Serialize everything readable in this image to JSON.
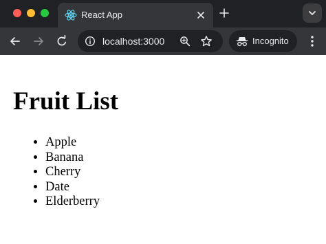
{
  "browser": {
    "tab_title": "React App",
    "url": "localhost:3000",
    "incognito_label": "Incognito",
    "icons": {
      "window_controls": [
        "close-window-icon",
        "minimize-window-icon",
        "maximize-window-icon"
      ],
      "tab": [
        "react-logo-icon",
        "close-icon"
      ],
      "tab_strip": [
        "plus-icon",
        "chevron-down-icon"
      ],
      "toolbar": [
        "arrow-left-icon",
        "arrow-right-icon",
        "reload-icon",
        "site-info-icon",
        "zoom-icon",
        "star-icon",
        "incognito-icon",
        "kebab-menu-icon"
      ]
    }
  },
  "page": {
    "title": "Fruit List",
    "items": [
      "Apple",
      "Banana",
      "Cherry",
      "Date",
      "Elderberry"
    ]
  },
  "colors": {
    "tab_strip_bg": "#202124",
    "toolbar_bg": "#35363a",
    "close_light": "#ff5f57",
    "minimize_light": "#febc2e",
    "maximize_light": "#28c840",
    "react_logo": "#61dafb"
  }
}
